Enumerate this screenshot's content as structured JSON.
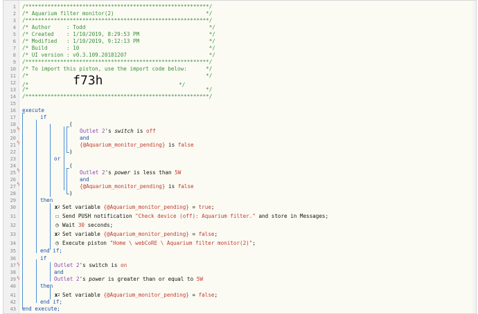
{
  "line_numbers": [
    "1",
    "2",
    "3",
    "4",
    "5",
    "6",
    "7",
    "8",
    "9",
    "10",
    "11",
    "12",
    "13",
    "14",
    "15",
    "16",
    "17",
    "18",
    "19",
    "20",
    "21",
    "22",
    "23",
    "24",
    "25",
    "26",
    "27",
    "28",
    "29",
    "30",
    "31",
    "32",
    "33",
    "34",
    "35",
    "36",
    "37",
    "38",
    "39",
    "40",
    "41",
    "42",
    "43"
  ],
  "header": {
    "stars": "/**********************************************************/",
    "l2": "/* Aquarium filter monitor(2)                             */",
    "l4": "/* Author     : Todd                                       */",
    "l5": "/* Created    : 1/10/2019, 8:29:53 PM                      */",
    "l6": "/* Modified   : 1/10/2019, 9:12:13 PM                      */",
    "l7": "/* Build      : 10                                         */",
    "l8": "/* UI version : v0.3.109.20181207                          */",
    "l10": "/* To import this piston, use the import code below:      */",
    "l11": "/*                                                        */",
    "l12_pre": "/*              ",
    "import_code": "f73h",
    "l12_post": "                        */",
    "l13": "/*                                                        */"
  },
  "code": {
    "execute": "execute",
    "if": "if",
    "open_paren": "(",
    "close_paren": ")",
    "and": "and",
    "or": "or",
    "then": "then",
    "end_if": "end if;",
    "end_execute": "end execute;",
    "outlet": "Outlet 2",
    "apos_s": "'s ",
    "switch_attr": "switch",
    "power_attr": "power",
    "is": " is ",
    "off": "off",
    "on": "on",
    "is_less_than": " is less than ",
    "is_ge": " is greater than or equal to ",
    "five_w": "5W",
    "pending_var": "{@Aquarium_monitor_pending}",
    "false_val": "false",
    "true_val": "true",
    "set_variable": "Set variable ",
    "assign": " = ",
    "semicolon": ";",
    "send_push": "Send PUSH notification ",
    "push_msg": "\"Check device (off): Aquarium filter.\"",
    "store_in": " and store in Messages;",
    "wait": "Wait ",
    "wait_value": "30",
    "seconds": " seconds;",
    "execute_piston": "Execute piston ",
    "piston_name": "\"Home \\ webCoRE \\ Aquarium filter monitor(2)\"",
    "x_icon": "x",
    "x_sup": "2"
  },
  "icons": {
    "bolt": "lightning-bolt-icon",
    "message": "speech-bubble-icon",
    "clock": "clock-icon",
    "variable": "x-squared-icon"
  },
  "colors": {
    "comment": "#3a8f3a",
    "keyword": "#1e4fa8",
    "device": "#8e44ad",
    "value": "#c0392b",
    "trigger": "#e2683c"
  }
}
